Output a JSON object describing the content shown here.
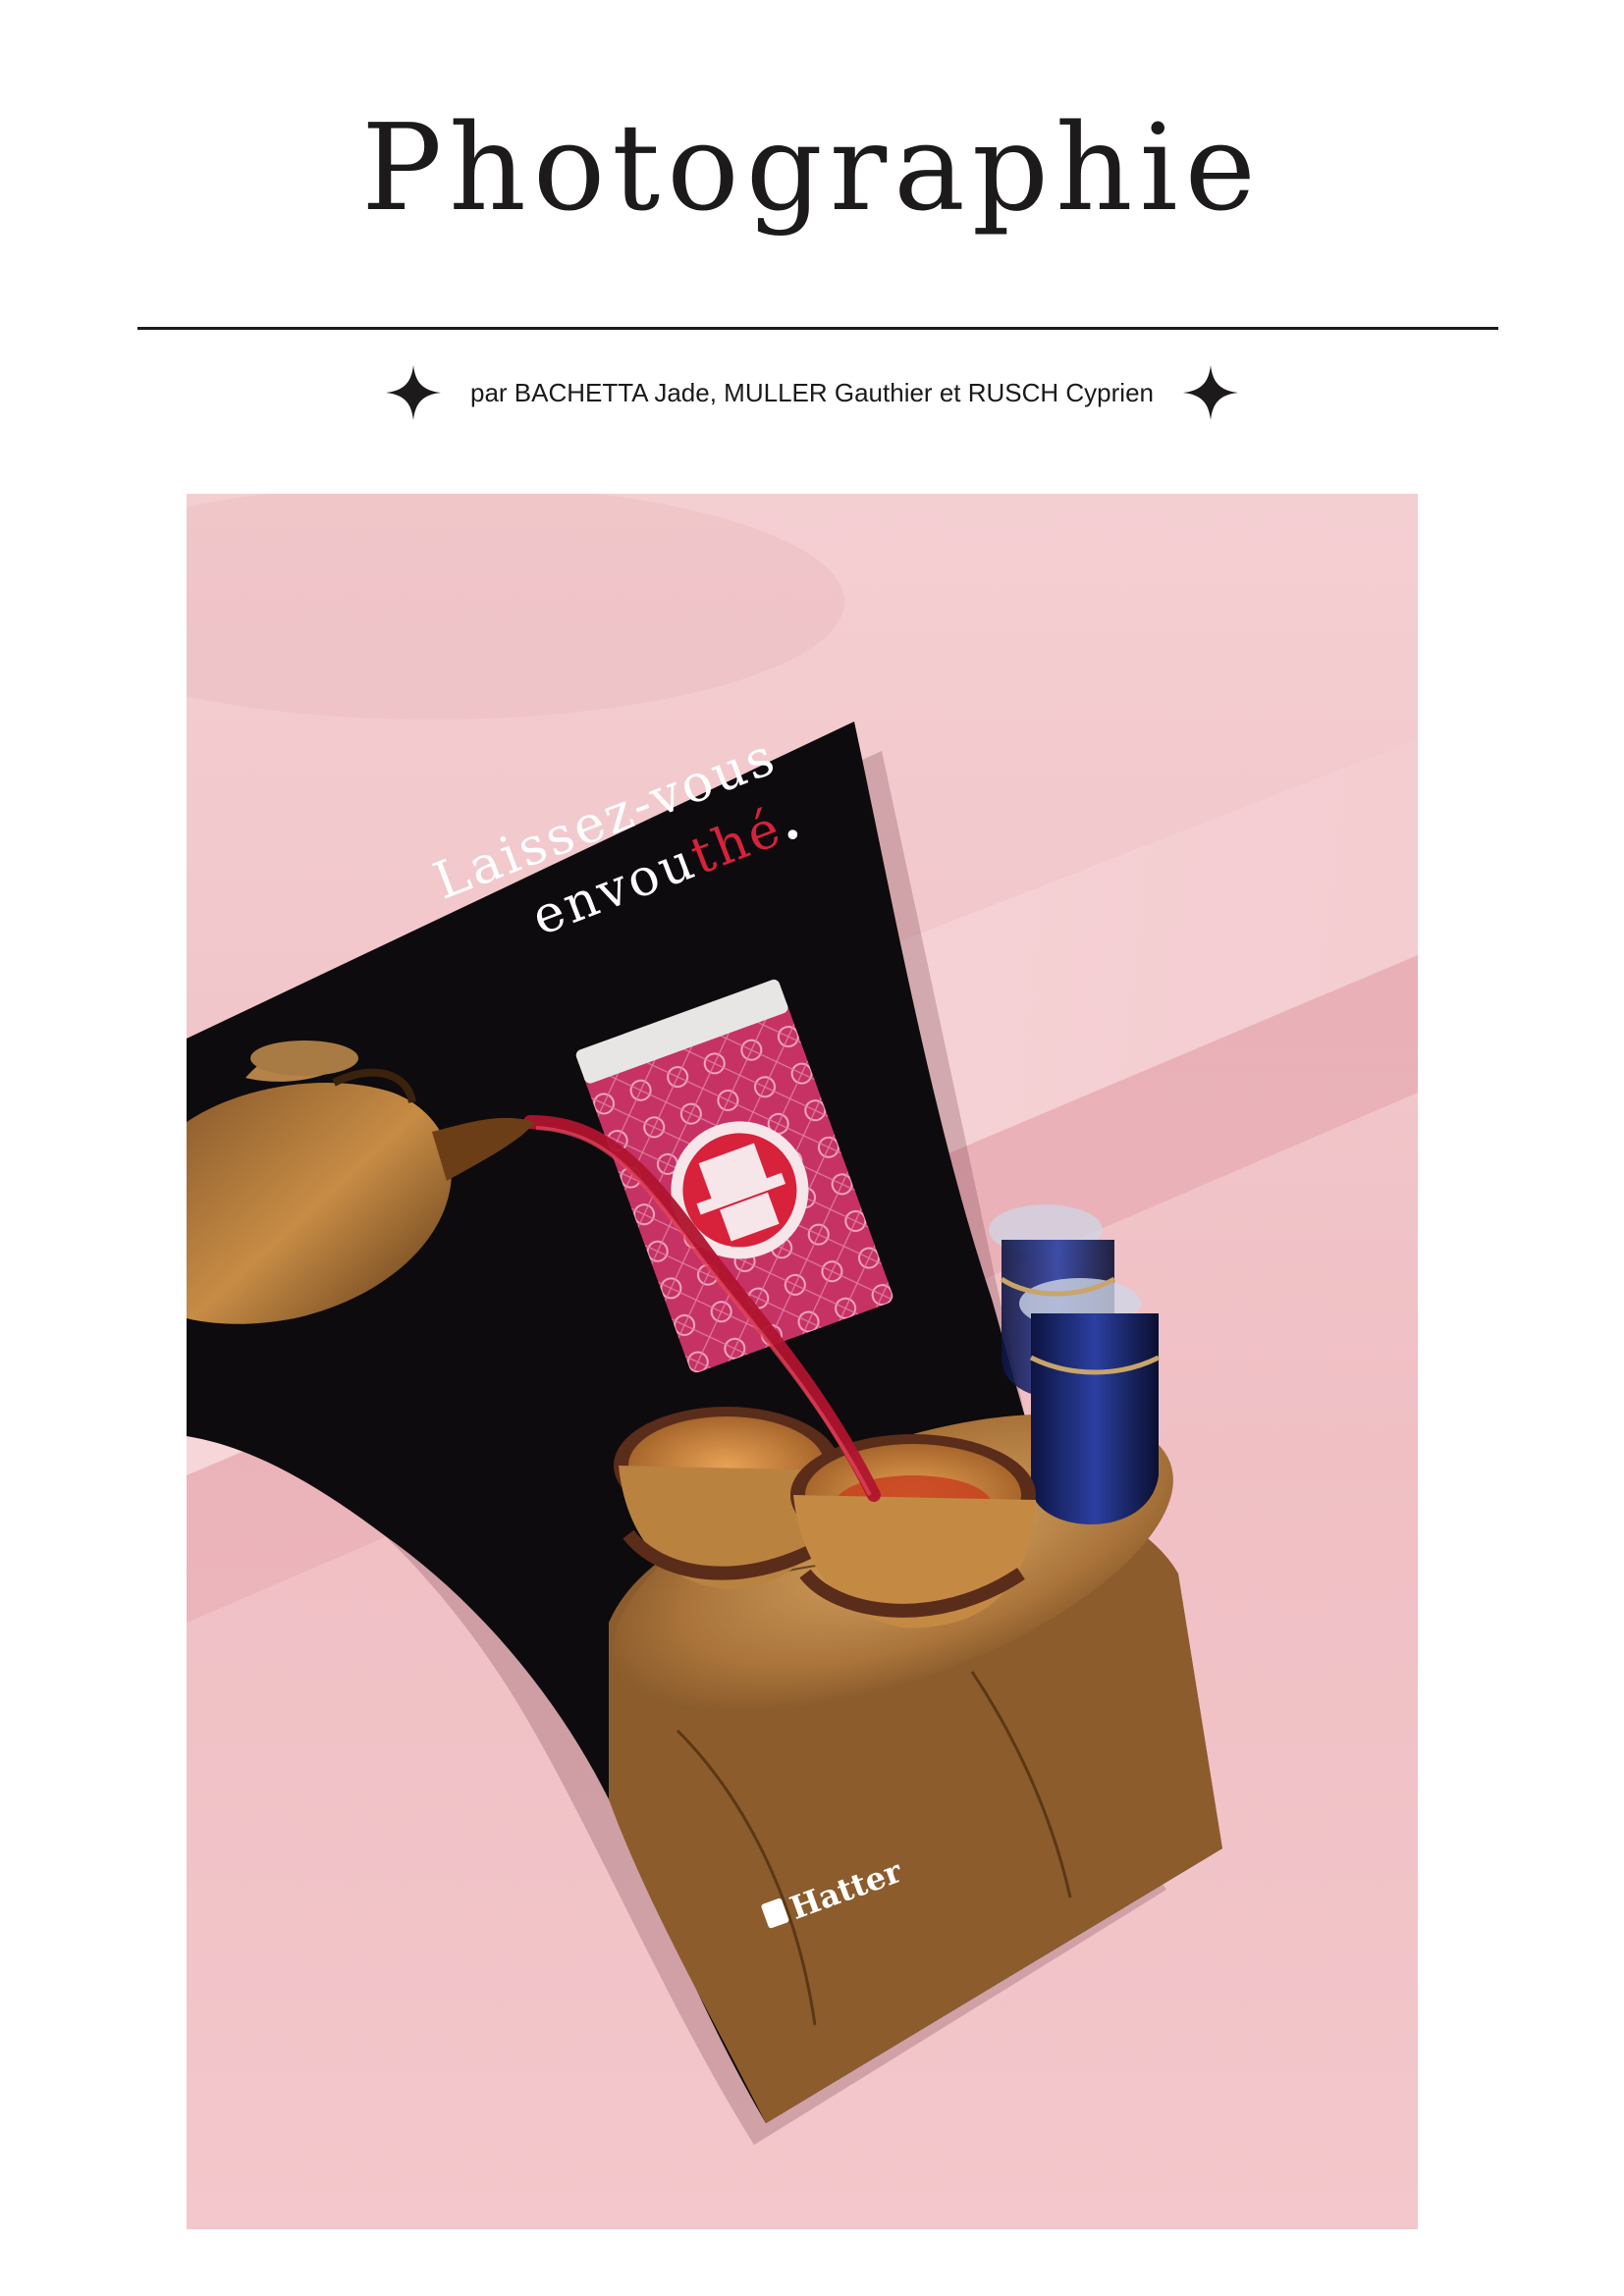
{
  "header": {
    "title": "Photographie",
    "byline": "par BACHETTA Jade, MULLER Gauthier et RUSCH Cyprien"
  },
  "poster": {
    "headline_line1": "Laissez-vous",
    "headline_line2_start": "envou",
    "headline_line2_accent": "thé",
    "headline_period": ".",
    "brand": "Hatter"
  },
  "colors": {
    "ink": "#1c1a1a",
    "background_pink": "#f1c2c8",
    "poster_black": "#0d0b0d",
    "accent_red": "#d8213b",
    "tin_magenta": "#c63264"
  },
  "icons": [
    "sparkle-icon",
    "sparkle-icon",
    "hat-logo-icon"
  ]
}
